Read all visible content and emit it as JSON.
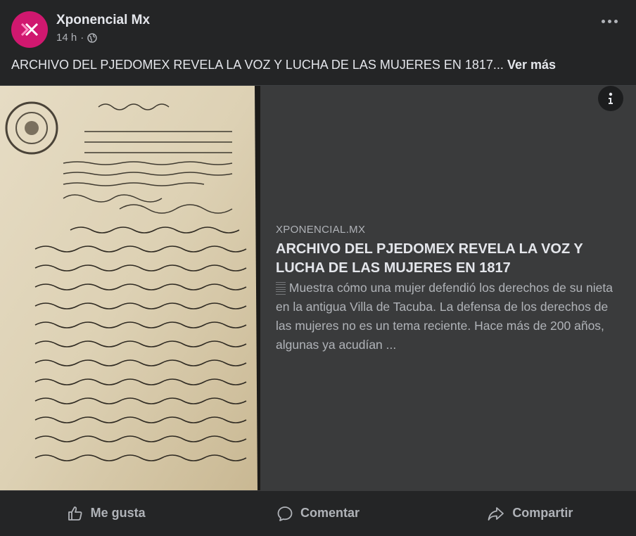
{
  "post": {
    "author": "Xponencial Mx",
    "time": "14 h",
    "separator": "·",
    "text": "ARCHIVO DEL PJEDOMEX REVELA LA VOZ Y LUCHA DE LAS MUJERES EN 1817...",
    "see_more": "Ver más"
  },
  "link": {
    "domain": "XPONENCIAL.MX",
    "title": "ARCHIVO DEL PJEDOMEX REVELA LA VOZ Y LUCHA DE LAS MUJERES EN 1817",
    "description": "𝄛 Muestra cómo una mujer defendió los derechos de su nieta en la antigua Villa de Tacuba. La defensa de los derechos de las mujeres no es un tema reciente. Hace más de 200 años, algunas ya acudían ..."
  },
  "actions": {
    "like": "Me gusta",
    "comment": "Comentar",
    "share": "Compartir"
  },
  "icons": {
    "avatar": "xponencial-logo",
    "privacy": "globe-icon",
    "menu": "more-dots-icon",
    "info": "info-icon",
    "like": "thumbs-up-icon",
    "comment": "comment-bubble-icon",
    "share": "share-arrow-icon"
  },
  "colors": {
    "background": "#242526",
    "card": "#3a3b3c",
    "brand": "#d0186f",
    "text_primary": "#e4e6eb",
    "text_secondary": "#b0b3b8"
  }
}
